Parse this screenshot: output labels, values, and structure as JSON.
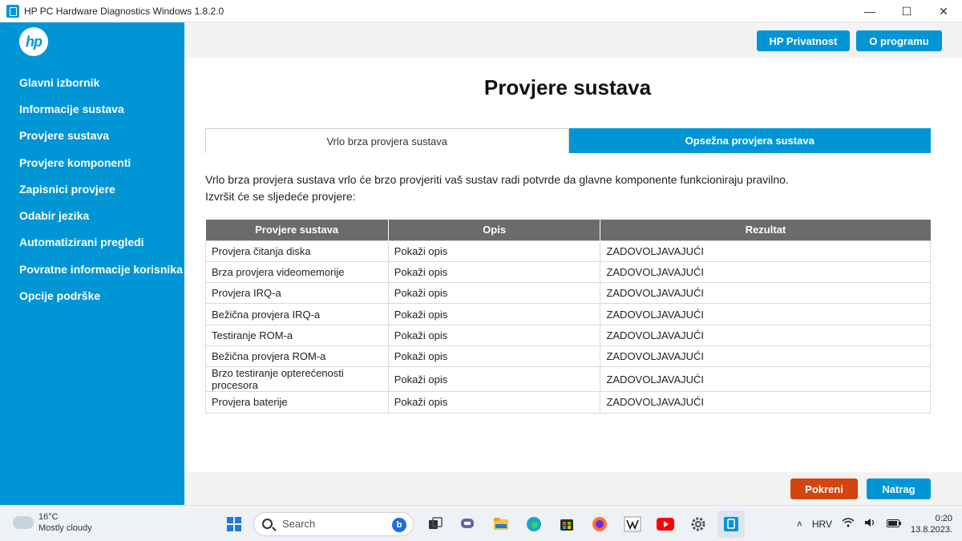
{
  "window": {
    "title": "HP PC Hardware Diagnostics Windows 1.8.2.0",
    "controls": [
      "—",
      "☐",
      "✕"
    ]
  },
  "logo": "hp",
  "sidebar": {
    "items": [
      {
        "label": "Glavni izbornik"
      },
      {
        "label": "Informacije sustava"
      },
      {
        "label": "Provjere sustava"
      },
      {
        "label": "Provjere komponenti"
      },
      {
        "label": "Zapisnici provjere"
      },
      {
        "label": "Odabir jezika"
      },
      {
        "label": "Automatizirani pregledi"
      },
      {
        "label": "Povratne informacije korisnika"
      },
      {
        "label": "Opcije podrške"
      }
    ]
  },
  "topbar": {
    "privacy_label": "HP Privatnost",
    "about_label": "O programu"
  },
  "main": {
    "title": "Provjere sustava",
    "tabs": [
      {
        "label": "Vrlo brza provjera sustava",
        "active": true
      },
      {
        "label": "Opsežna provjera sustava",
        "active": false
      }
    ],
    "description_line1": "Vrlo brza provjera sustava vrlo će brzo provjeriti vaš sustav radi potvrde da glavne komponente funkcioniraju pravilno.",
    "description_line2": "Izvršit će se sljedeće provjere:",
    "table": {
      "headers": [
        "Provjere sustava",
        "Opis",
        "Rezultat"
      ],
      "rows": [
        {
          "name": "Provjera čitanja diska",
          "link": "Pokaži opis",
          "result": "ZADOVOLJAVAJUĆI"
        },
        {
          "name": "Brza provjera videomemorije",
          "link": "Pokaži opis",
          "result": "ZADOVOLJAVAJUĆI"
        },
        {
          "name": "Provjera IRQ-a",
          "link": "Pokaži opis",
          "result": "ZADOVOLJAVAJUĆI"
        },
        {
          "name": "Bežična provjera IRQ-a",
          "link": "Pokaži opis",
          "result": "ZADOVOLJAVAJUĆI"
        },
        {
          "name": "Testiranje ROM-a",
          "link": "Pokaži opis",
          "result": "ZADOVOLJAVAJUĆI"
        },
        {
          "name": "Bežična provjera ROM-a",
          "link": "Pokaži opis",
          "result": "ZADOVOLJAVAJUĆI"
        },
        {
          "name": "Brzo testiranje opterećenosti procesora",
          "link": "Pokaži opis",
          "result": "ZADOVOLJAVAJUĆI"
        },
        {
          "name": "Provjera baterije",
          "link": "Pokaži opis",
          "result": "ZADOVOLJAVAJUĆI"
        }
      ]
    }
  },
  "bottombar": {
    "start_label": "Pokreni",
    "back_label": "Natrag"
  },
  "taskbar": {
    "weather_temp": "16°C",
    "weather_desc": "Mostly cloudy",
    "search_placeholder": "Search",
    "language": "HRV",
    "time": "0:20",
    "date": "13.8.2023."
  },
  "colors": {
    "accent": "#0096d6",
    "start_button": "#d4440f",
    "header_gray": "#6b6b6b",
    "pass_green": "#1a8a1a",
    "link_blue": "#1a73c0"
  }
}
